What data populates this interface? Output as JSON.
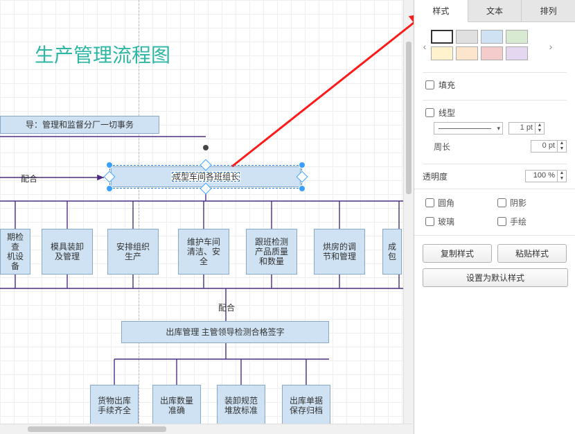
{
  "canvas": {
    "title": "生产管理流程图",
    "top_box": "导：管理和监督分厂一切事务",
    "selected": "成型车间各班组长",
    "edge_label_coop": "配合",
    "boxes_row": [
      "期检查\n机设备",
      "模具装卸\n及管理",
      "安排组织\n生产",
      "维护车间\n清洁、安\n全",
      "跟班检测\n产品质量\n和数量",
      "烘房的调\n节和管理",
      "成\n包"
    ],
    "mid_box": "出库管理  主管领导检测合格签字",
    "bottom_row": [
      "货物出库\n手续齐全",
      "出库数量\n准确",
      "装卸规范\n堆放标准",
      "出库单据\n保存归档"
    ]
  },
  "panel": {
    "tabs": [
      "样式",
      "文本",
      "排列"
    ],
    "swatches": [
      "#ffffff",
      "#e0e0e0",
      "#cfe2f3",
      "#d9ead3",
      "#fff2cc",
      "#fce5cd",
      "#f4cccc",
      "#e4d7ef"
    ],
    "fill": "填充",
    "stroke": "线型",
    "stroke_width": "1 pt",
    "perimeter": "周长",
    "perimeter_val": "0 pt",
    "opacity": "透明度",
    "opacity_val": "100 %",
    "rounded": "圆角",
    "shadow": "阴影",
    "glass": "玻璃",
    "sketch": "手绘",
    "copy_style": "复制样式",
    "paste_style": "粘贴样式",
    "set_default": "设置为默认样式"
  }
}
